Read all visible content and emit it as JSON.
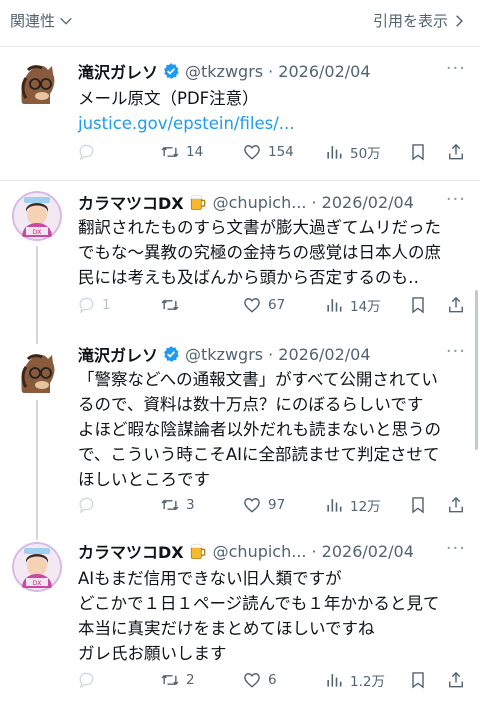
{
  "header": {
    "sort_label": "関連性",
    "quotes_label": "引用を表示"
  },
  "tweets": [
    {
      "author": "滝沢ガレソ",
      "handle": "@tkzwgrs",
      "date": "· 2026/02/04",
      "lines": [
        "メール原文（PDF注意）"
      ],
      "link": "justice.gov/epstein/files/...",
      "replies": "",
      "retweets": "14",
      "likes": "154",
      "views": "50万"
    },
    {
      "author": "カラマツコDX",
      "handle": "@chupich...",
      "date": "· 2026/02/04",
      "lines": [
        "翻訳されたものすら文書が膨大過ぎてムリだった",
        "でもな〜異教の究極の金持ちの感覚は日本人の庶",
        "民には考えも及ばんから頭から否定するのも‥"
      ],
      "replies": "1",
      "retweets": "",
      "likes": "67",
      "views": "14万"
    },
    {
      "author": "滝沢ガレソ",
      "handle": "@tkzwgrs",
      "date": "· 2026/02/04",
      "lines": [
        "「警察などへの通報文書」がすべて公開されてい",
        "るので、資料は数十万点？にのぼるらしいです",
        "よほど暇な陰謀論者以外だれも読まないと思うの",
        "で、こういう時こそAIに全部読ませて判定させて",
        "ほしいところです"
      ],
      "replies": "",
      "retweets": "3",
      "likes": "97",
      "views": "12万"
    },
    {
      "author": "カラマツコDX",
      "handle": "@chupich...",
      "date": "· 2026/02/04",
      "lines": [
        "AIもまだ信用できない旧人類ですが",
        "どこかで１日１ページ読んでも１年かかると見て",
        "本当に真実だけをまとめてほしいですね",
        "ガレ氏お願いします"
      ],
      "replies": "",
      "retweets": "2",
      "likes": "6",
      "views": "1.2万"
    }
  ]
}
